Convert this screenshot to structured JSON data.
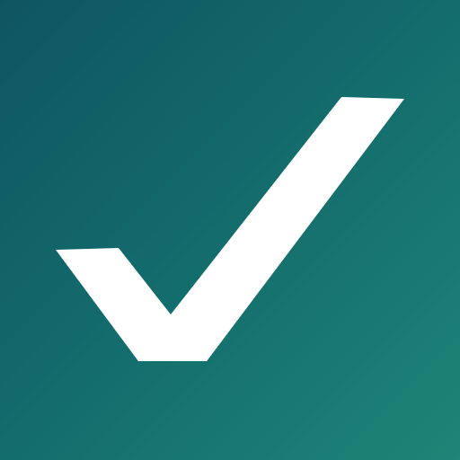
{
  "icon": {
    "name": "checkmark-icon",
    "colors": {
      "background_start": "#0f5560",
      "background_mid": "#136a6c",
      "background_end": "#1e8577",
      "check": "#ffffff"
    }
  }
}
